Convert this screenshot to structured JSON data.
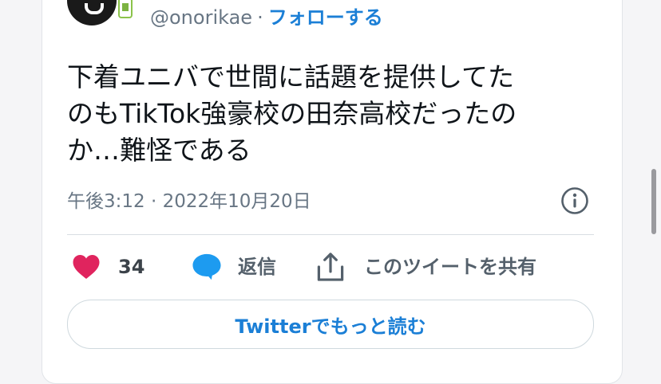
{
  "header": {
    "handle": "@onorikae",
    "separator": "·",
    "follow_label": "フォローする"
  },
  "tweet": {
    "lines": [
      "下着ユニバで世間に話題を提供してた",
      "のもTikTok強豪校の田奈高校だったの",
      "か…難怪である"
    ],
    "timestamp": "午後3:12 · 2022年10月20日"
  },
  "actions": {
    "like_count": "34",
    "reply_label": "返信",
    "share_label": "このツイートを共有"
  },
  "read_more_label": "Twitterでもっと読む",
  "colors": {
    "like_pink": "#e0245e",
    "reply_blue": "#1d9bf0",
    "link_blue": "#1b7fd6",
    "muted_text": "#687684"
  },
  "icons": [
    "heart-icon",
    "speech-bubble-icon",
    "share-icon",
    "info-icon"
  ]
}
